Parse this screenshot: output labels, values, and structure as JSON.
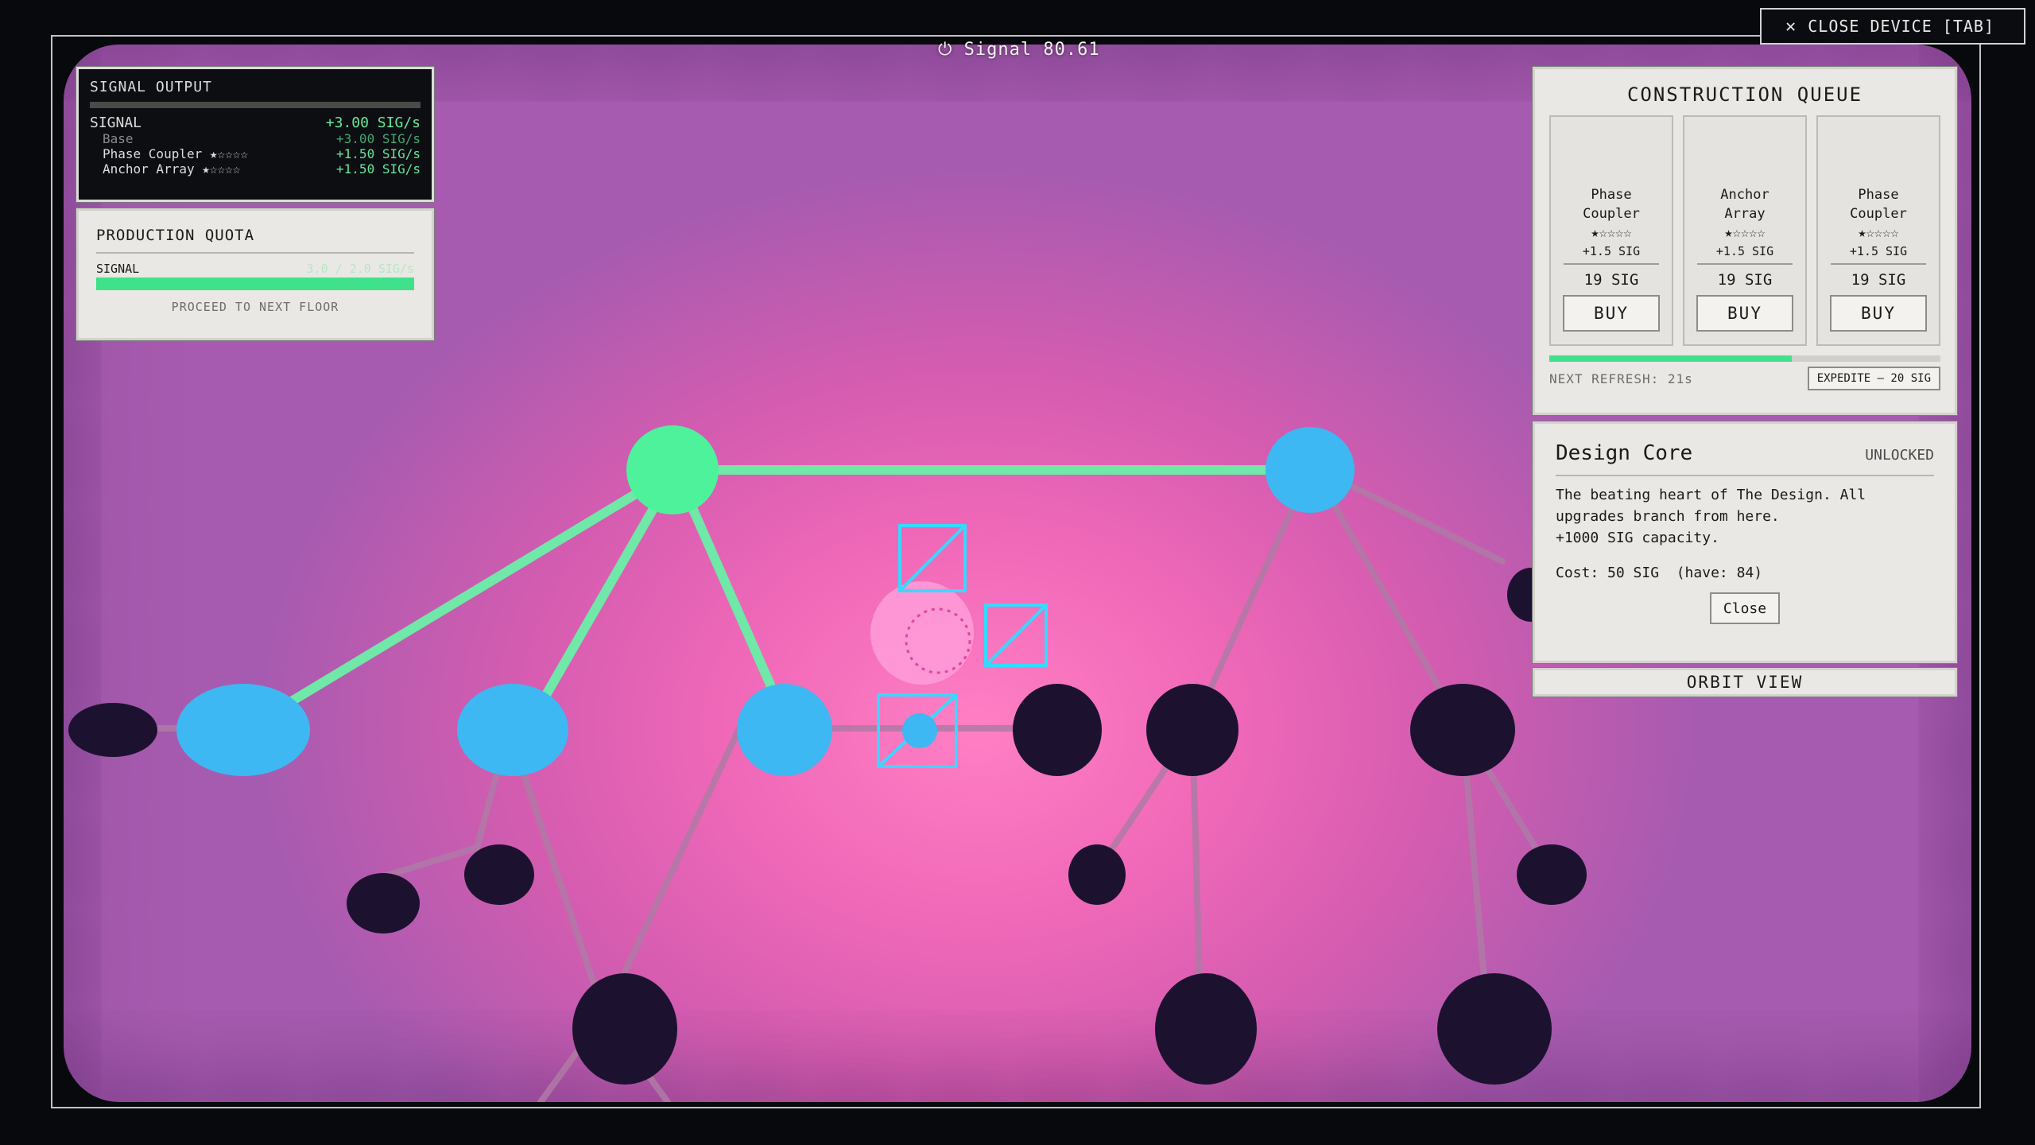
{
  "header": {
    "title": "Signal 80.61",
    "close_device": "CLOSE DEVICE [TAB]"
  },
  "signal_output": {
    "title": "SIGNAL OUTPUT",
    "main_label": "SIGNAL",
    "main_value": "+3.00 SIG/s",
    "rows": [
      {
        "label": "Base",
        "stars": "",
        "value": "+3.00 SIG/s"
      },
      {
        "label": "Phase Coupler",
        "stars": "★☆☆☆☆",
        "value": "+1.50 SIG/s"
      },
      {
        "label": "Anchor Array",
        "stars": "★☆☆☆☆",
        "value": "+1.50 SIG/s"
      }
    ]
  },
  "quota": {
    "title": "PRODUCTION QUOTA",
    "label": "SIGNAL",
    "value": "3.0 / 2.0 SIG/s",
    "progress": 1.0,
    "next": "PROCEED TO NEXT FLOOR"
  },
  "queue": {
    "title": "CONSTRUCTION QUEUE",
    "cards": [
      {
        "name": "Phase Coupler",
        "stars": "★☆☆☆☆",
        "rate": "+1.5 SIG",
        "cost": "19 SIG",
        "buy": "BUY"
      },
      {
        "name": "Anchor Array",
        "stars": "★☆☆☆☆",
        "rate": "+1.5 SIG",
        "cost": "19 SIG",
        "buy": "BUY"
      },
      {
        "name": "Phase Coupler",
        "stars": "★☆☆☆☆",
        "rate": "+1.5 SIG",
        "cost": "19 SIG",
        "buy": "BUY"
      }
    ],
    "refresh_progress": 0.62,
    "refresh_label": "NEXT REFRESH: 21s",
    "expedite": "EXPEDITE — 20 SIG"
  },
  "core": {
    "title": "Design Core",
    "status": "UNLOCKED",
    "desc_lines": [
      "The beating heart of The Design. All",
      "upgrades branch from here.",
      "+1000 SIG capacity."
    ],
    "cost": "Cost: 50 SIG  (have: 84)",
    "close": "Close"
  },
  "orbit_view": "ORBIT VIEW",
  "colors": {
    "node_active": "#4ef29a",
    "node_unlocked": "#3db8f2",
    "node_locked": "#1c1230",
    "edge_active": "#6fe8a8",
    "background_glow": "#ff7fc4"
  }
}
